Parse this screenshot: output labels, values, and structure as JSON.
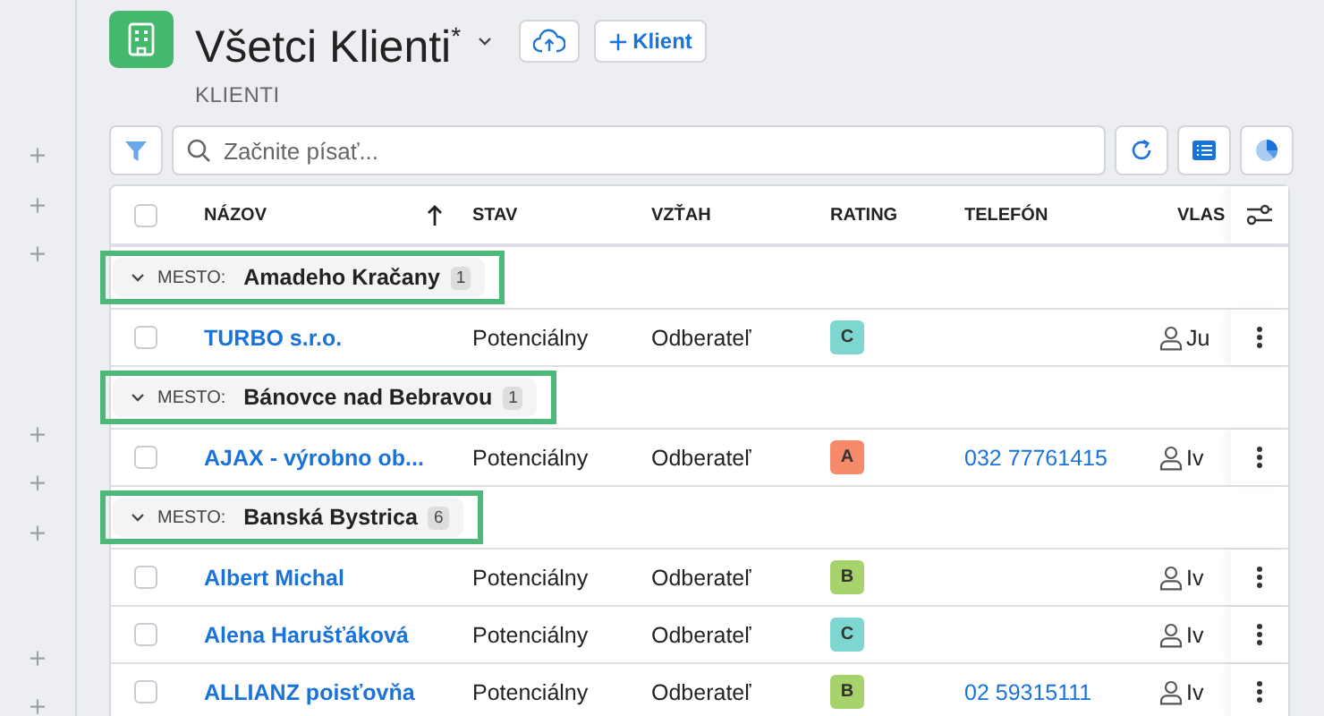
{
  "header": {
    "title": "Všetci Klienti$^{*}$",
    "subtitle": "KLIENTI",
    "add_button": "Klient"
  },
  "toolbar": {
    "search": {
      "placeholder": "Začnite písať..."
    }
  },
  "table": {
    "columns": [
      {
        "label": "NÁZOV",
        "sorted": true
      },
      {
        "label": "STAV",
        "sorted": false
      },
      {
        "label": "VZŤAH",
        "sorted": false
      },
      {
        "label": "RATING",
        "sorted": false
      },
      {
        "label": "TELEFÓN",
        "sorted": false
      },
      {
        "label": "VLAS",
        "sorted": false
      }
    ],
    "select_all": {
      "checked": false
    },
    "groups": [
      {
        "label": "MESTO:",
        "name": "Amadeho Kračany",
        "count": "1",
        "expanded": true,
        "highlighted": true,
        "rows": [
          {
            "name": "TURBO s.r.o.",
            "status": "Potenciálny",
            "relation": "Odberateľ",
            "rating": {
              "label": "C",
              "color": "#7dd6d0"
            },
            "phone": "",
            "owner": "Ju",
            "checked": false
          }
        ]
      },
      {
        "label": "MESTO:",
        "name": "Bánovce nad Bebravou",
        "count": "1",
        "expanded": true,
        "highlighted": true,
        "rows": [
          {
            "name": "AJAX - výrobno ob...",
            "status": "Potenciálny",
            "relation": "Odberateľ",
            "rating": {
              "label": "A",
              "color": "#f78a6b"
            },
            "phone": "032 77761415",
            "owner": "Iv",
            "checked": false
          }
        ]
      },
      {
        "label": "MESTO:",
        "name": "Banská Bystrica",
        "count": "6",
        "expanded": true,
        "highlighted": true,
        "rows": [
          {
            "name": "Albert Michal",
            "status": "Potenciálny",
            "relation": "Odberateľ",
            "rating": {
              "label": "B",
              "color": "#a6d36c"
            },
            "phone": "",
            "owner": "Iv",
            "checked": false
          },
          {
            "name": "Alena Harušťáková",
            "status": "Potenciálny",
            "relation": "Odberateľ",
            "rating": {
              "label": "C",
              "color": "#7dd6d0"
            },
            "phone": "",
            "owner": "Iv",
            "checked": false
          },
          {
            "name": "ALLIANZ poisťovňa",
            "status": "Potenciálny",
            "relation": "Odberateľ",
            "rating": {
              "label": "B",
              "color": "#a6d36c"
            },
            "phone": "02 59315111",
            "owner": "Iv",
            "checked": false
          }
        ]
      }
    ]
  }
}
